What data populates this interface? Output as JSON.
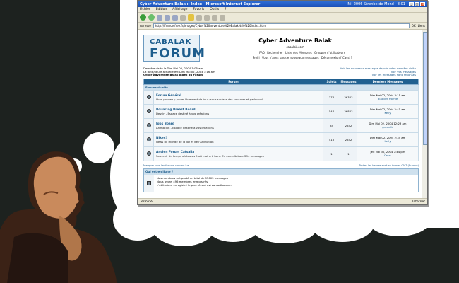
{
  "browser": {
    "title": "Cyber Adventure Balak :: Index - Microsoft Internet Explorer",
    "title_right": "Ni: 2006 Strenbe de Mond - 8:01",
    "menu": [
      "Fichier",
      "Edition",
      "Affichage",
      "Favoris",
      "Outils",
      "?"
    ],
    "address_label": "Adresse",
    "address_value": "http://ifrance.free.fr/images/Cyber%20adventure%20Balak%20%20Index.htm",
    "go_label": "OK",
    "links_label": "Liens",
    "status_left": "Terminé",
    "status_right": "Internet"
  },
  "forum": {
    "logo_line1": "CABALAK",
    "logo_line2": "FORUM",
    "site_title": "Cyber Adventure Balak",
    "site_url": "cabalak.com",
    "nav": [
      "FAQ",
      "Rechercher",
      "Liste des Membres",
      "Groupes d'utilisateurs",
      "Profil",
      "Vous n'avez pas de nouveaux messages",
      "Déconnexion [ Cassi ]"
    ],
    "info_left": [
      "Dernière visite le Dim Mai 02, 2004 1:05 am",
      "La date/heure actuelle est Dim Mai 02, 2004 3:16 am",
      "Cyber Adventure Balak Index du Forum"
    ],
    "info_right": [
      "Voir les nouveaux messages depuis votre dernière visite",
      "Voir vos messages",
      "Voir les messages sans réponses"
    ],
    "columns": [
      "Forum",
      "Sujets",
      "Messages",
      "Derniers Messages"
    ],
    "category": "Forums du site",
    "forums": [
      {
        "name": "Forum Général",
        "desc": "Vous pouvez y parler librement de tout (sous surface des consoles et parler cul)",
        "topics": "376",
        "posts": "26303",
        "last_date": "Dim Mai 02, 2004 3:15 am",
        "last_user": "Blagger Hornie"
      },
      {
        "name": "Bouncing Breast Board",
        "desc": "Dessin - Espace destiné à vos créations",
        "topics": "544",
        "posts": "26803",
        "last_date": "Dim Mai 02, 2004 2:41 am",
        "last_user": "Kelly"
      },
      {
        "name": "Jobs Board",
        "desc": "Animation - Espace destiné à vos créations",
        "topics": "85",
        "posts": "2542",
        "last_date": "Dim Mai 02, 2004 12:23 am",
        "last_user": "greenlib"
      },
      {
        "name": "Nikes!",
        "desc": "News du monde de la BD et de l'Animation",
        "topics": "415",
        "posts": "2542",
        "last_date": "Dim Mai 02, 2004 2:35 am",
        "last_user": "Kelly"
      },
      {
        "name": "Ancien Forum Catsalia",
        "desc": "Souvenir du temps où toutes était moins à bord. En consultation. 294 messages",
        "topics": "1",
        "posts": "1",
        "last_date": "Jeu Mai 30, 2004 7:44 pm",
        "last_user": "Cassi"
      }
    ],
    "footer_left": "Marquer tous les forums comme lus",
    "footer_right": "Toutes les heures sont au format GMT (Europe)",
    "online_title": "Qui est en ligne ?",
    "online_lines": [
      "Nos membres ont posté un total de 95603 messages",
      "Nous avons 495 membres enregistrés",
      "L'utilisateur enregistré le plus récent est zarsorthanann"
    ]
  }
}
